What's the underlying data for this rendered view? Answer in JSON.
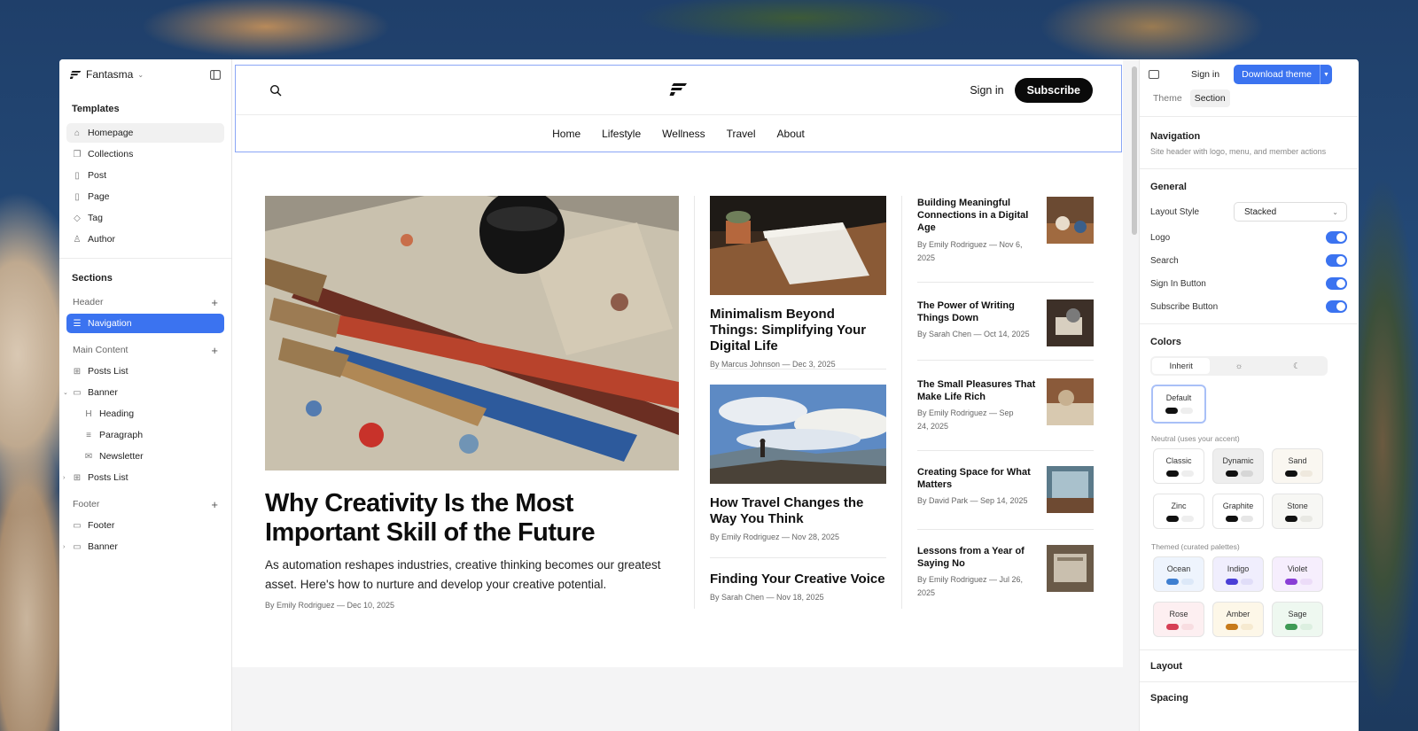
{
  "sidebar": {
    "brand": "Fantasma",
    "templates_title": "Templates",
    "templates": [
      {
        "label": "Homepage",
        "icon": "home-icon"
      },
      {
        "label": "Collections",
        "icon": "collections-icon"
      },
      {
        "label": "Post",
        "icon": "document-icon"
      },
      {
        "label": "Page",
        "icon": "document-icon"
      },
      {
        "label": "Tag",
        "icon": "tag-icon"
      },
      {
        "label": "Author",
        "icon": "user-icon"
      }
    ],
    "sections_title": "Sections",
    "groups": {
      "header": "Header",
      "main": "Main Content",
      "footer": "Footer"
    },
    "items": {
      "navigation": "Navigation",
      "posts_list": "Posts List",
      "banner": "Banner",
      "heading": "Heading",
      "paragraph": "Paragraph",
      "newsletter": "Newsletter",
      "posts_list_2": "Posts List",
      "footer": "Footer",
      "banner_2": "Banner"
    }
  },
  "site": {
    "signin": "Sign in",
    "subscribe": "Subscribe",
    "nav": [
      "Home",
      "Lifestyle",
      "Wellness",
      "Travel",
      "About"
    ],
    "hero": {
      "title": "Why Creativity Is the Most Important Skill of the Future",
      "excerpt": "As automation reshapes industries, creative thinking becomes our greatest asset. Here's how to nurture and develop your creative potential.",
      "meta": "By Emily Rodriguez — Dec 10, 2025"
    },
    "middle": [
      {
        "title": "Minimalism Beyond Things: Simplifying Your Digital Life",
        "meta": "By Marcus Johnson — Dec 3, 2025"
      },
      {
        "title": "How Travel Changes the Way You Think",
        "meta": "By Emily Rodriguez — Nov 28, 2025"
      },
      {
        "title": "Finding Your Creative Voice",
        "meta": "By Sarah Chen — Nov 18, 2025"
      }
    ],
    "side": [
      {
        "title": "Building Meaningful Connections in a Digital Age",
        "meta": "By Emily Rodriguez — Nov 6, 2025"
      },
      {
        "title": "The Power of Writing Things Down",
        "meta": "By Sarah Chen — Oct 14, 2025"
      },
      {
        "title": "The Small Pleasures That Make Life Rich",
        "meta": "By Emily Rodriguez — Sep 24, 2025"
      },
      {
        "title": "Creating Space for What Matters",
        "meta": "By David Park — Sep 14, 2025"
      },
      {
        "title": "Lessons from a Year of Saying No",
        "meta": "By Emily Rodriguez — Jul 26, 2025"
      }
    ]
  },
  "panel": {
    "signin": "Sign in",
    "download": "Download theme",
    "tabs": [
      "Theme",
      "Section"
    ],
    "section_title": "Navigation",
    "section_desc": "Site header with logo, menu, and member actions",
    "general": "General",
    "layout_style_label": "Layout Style",
    "layout_style_value": "Stacked",
    "toggles": [
      "Logo",
      "Search",
      "Sign In Button",
      "Subscribe Button"
    ],
    "colors": "Colors",
    "color_mode": [
      "Inherit",
      "light-icon",
      "dark-icon"
    ],
    "default_swatch": "Default",
    "neutral_label": "Neutral (uses your accent)",
    "neutral": [
      "Classic",
      "Dynamic",
      "Sand",
      "Zinc",
      "Graphite",
      "Stone"
    ],
    "themed_label": "Themed (curated palettes)",
    "themed": [
      "Ocean",
      "Indigo",
      "Violet",
      "Rose",
      "Amber",
      "Sage"
    ],
    "layout": "Layout",
    "spacing": "Spacing"
  },
  "colors": {
    "accent": "#3b73f0",
    "ocean": "#3f7fd0",
    "indigo": "#4b3fd6",
    "violet": "#8a3fd6",
    "rose": "#d63f55",
    "amber": "#c77a1a",
    "sage": "#3f9a55"
  }
}
